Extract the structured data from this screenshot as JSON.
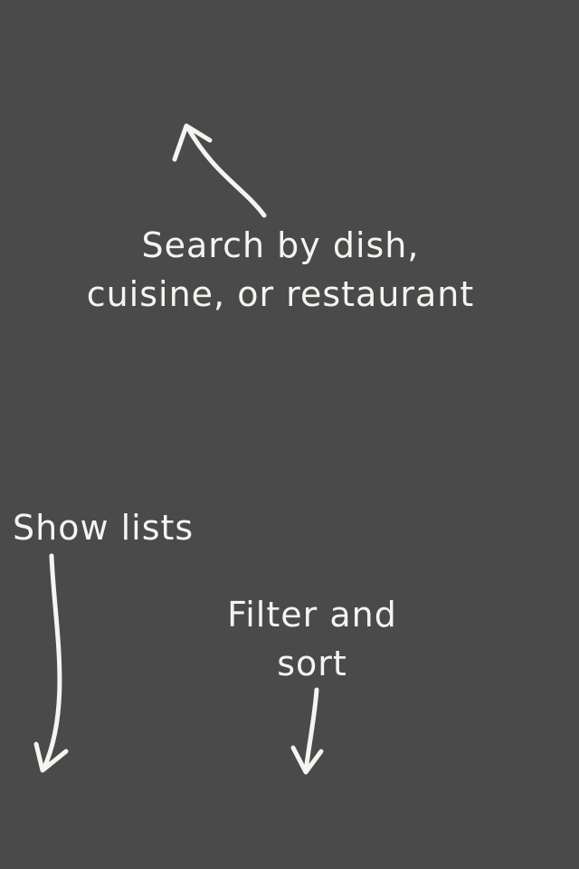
{
  "overlay": {
    "background_color": "#4a4a4a",
    "text_color": "#f4f4f0",
    "hints": {
      "search": {
        "line1": "Search by dish,",
        "line2": "cuisine, or restaurant",
        "arrow_icon": "arrow-up-left-icon"
      },
      "lists": {
        "label": "Show lists",
        "arrow_icon": "arrow-down-icon"
      },
      "filter": {
        "line1": "Filter and",
        "line2": "sort",
        "arrow_icon": "arrow-down-icon"
      }
    }
  }
}
